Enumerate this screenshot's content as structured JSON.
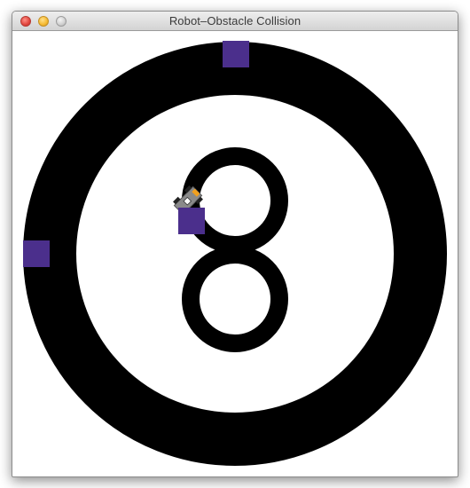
{
  "window": {
    "title": "Robot–Obstacle Collision"
  },
  "colors": {
    "track": "#000000",
    "background": "#ffffff",
    "obstacle": "#4b2f8c",
    "robot_body": "#8a8a8a",
    "robot_accent": "#f0a020"
  },
  "icons": {
    "close": "close-dot-icon",
    "minimize": "minimize-dot-icon",
    "zoom": "zoom-dot-icon",
    "robot": "robot-icon"
  }
}
